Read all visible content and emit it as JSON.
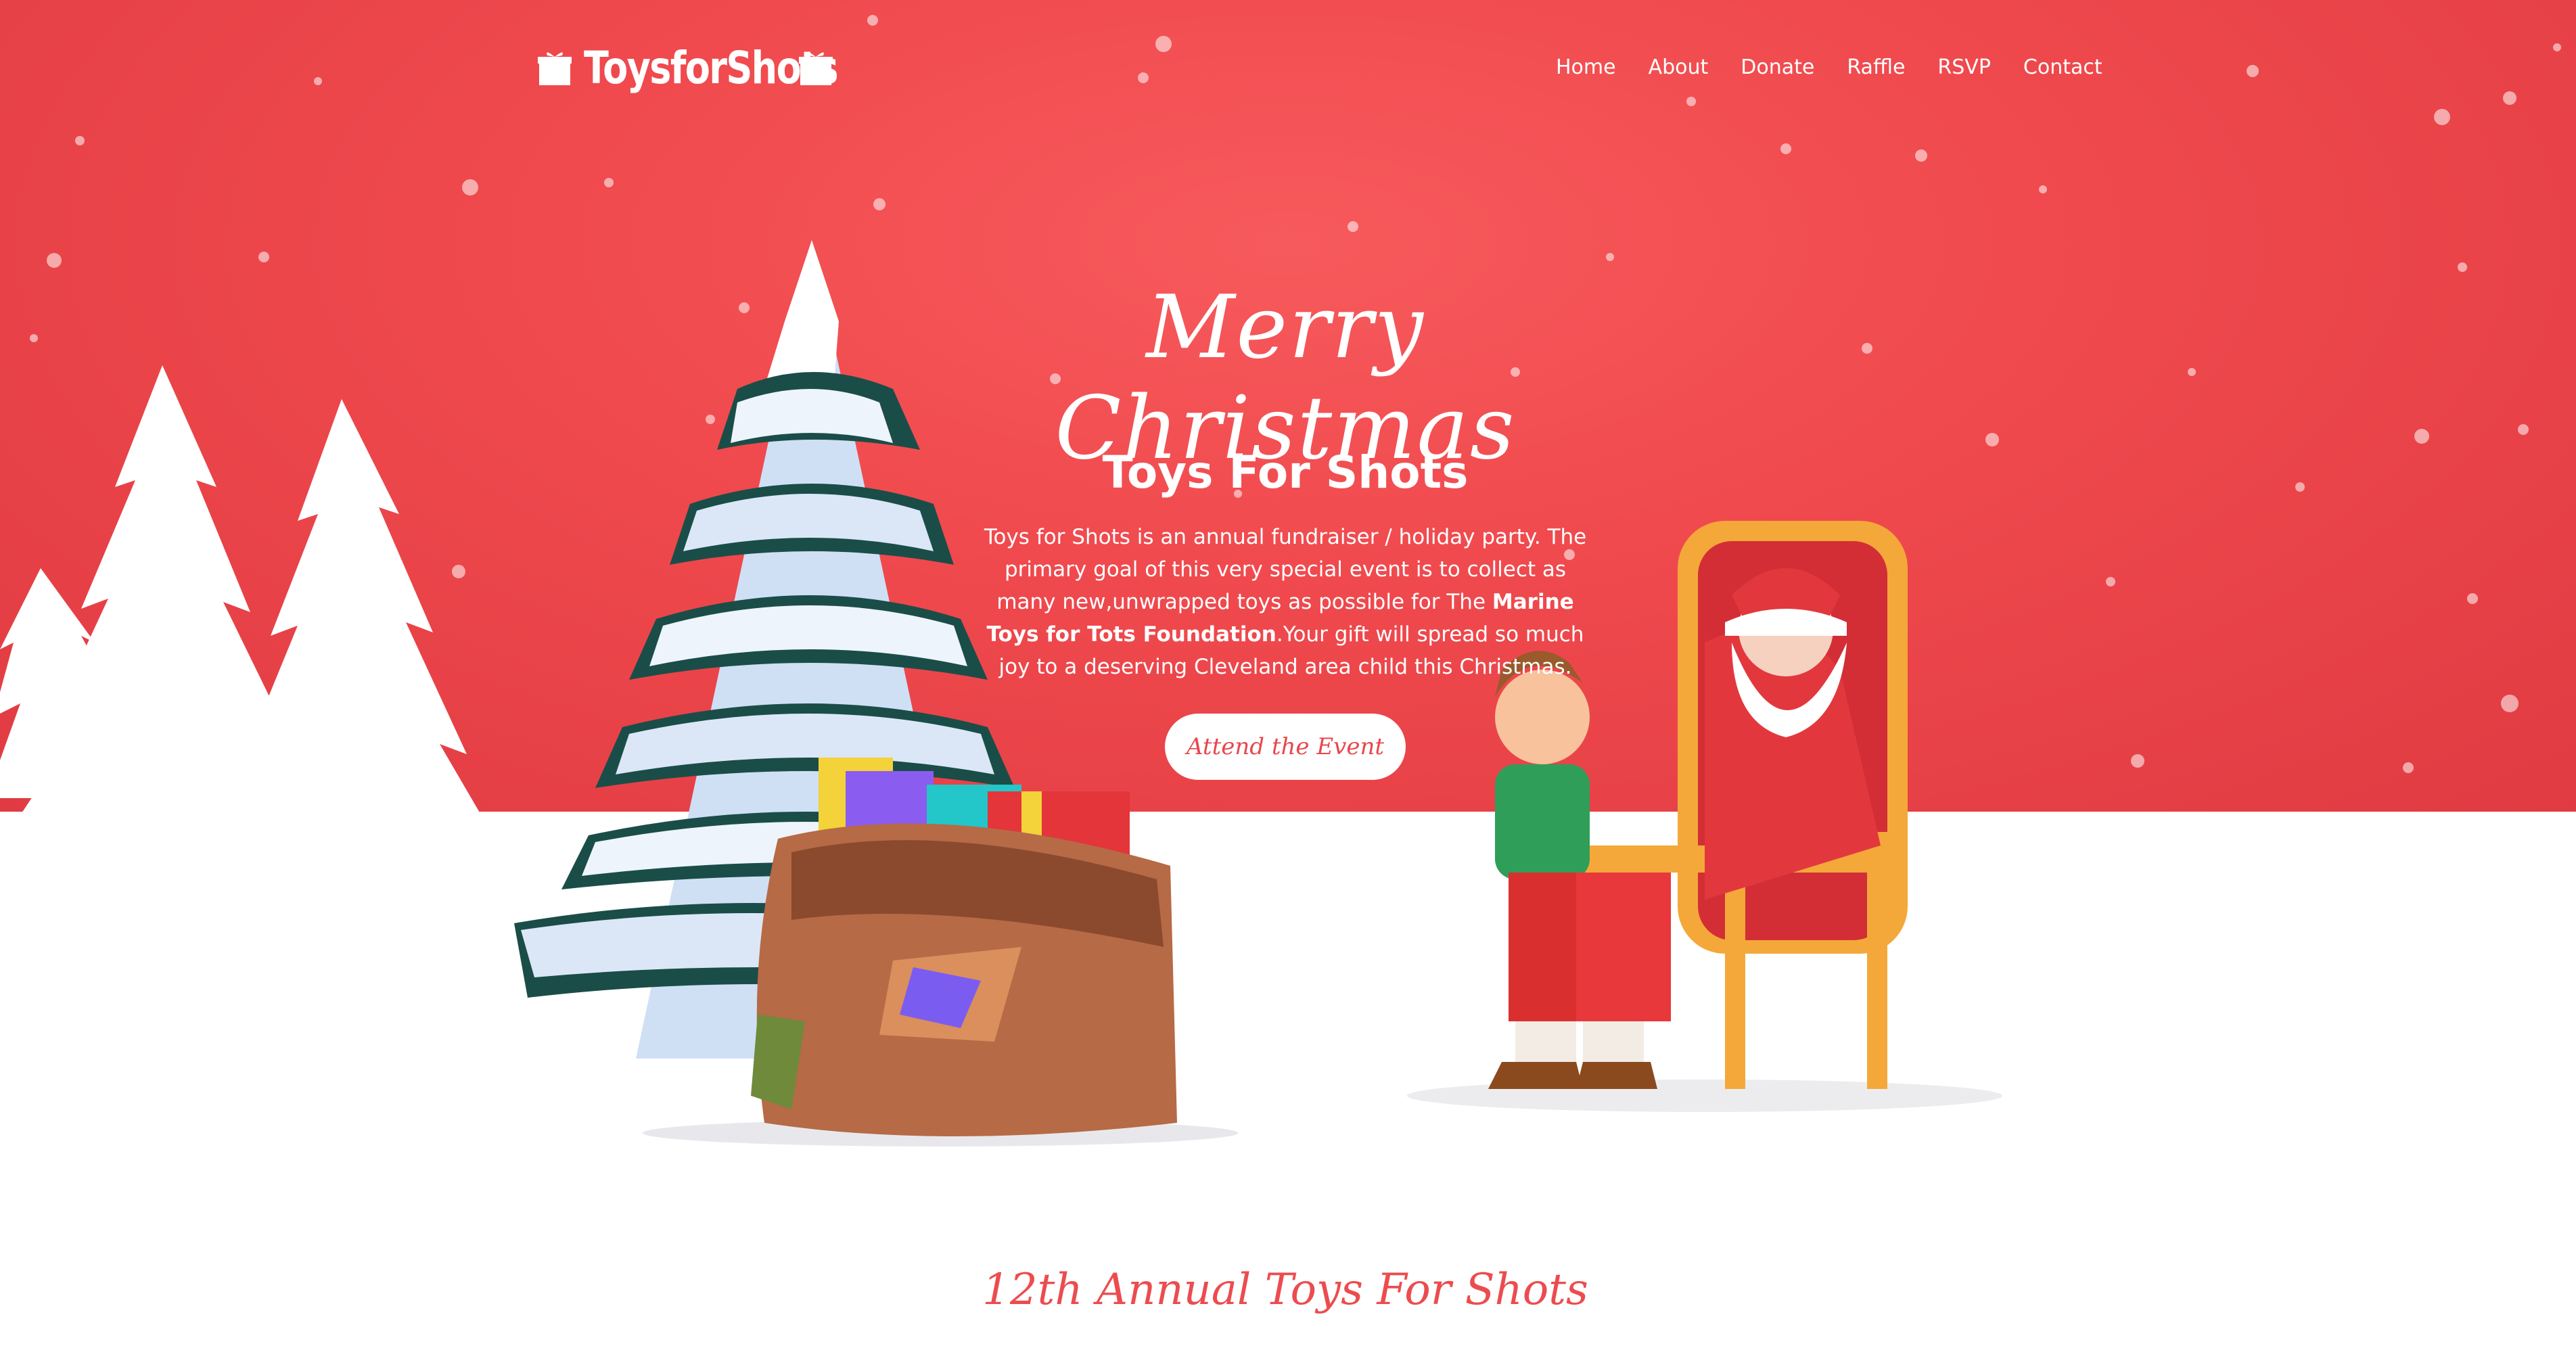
{
  "brand": {
    "logo_text": "ToysforShots"
  },
  "nav": {
    "items": [
      "Home",
      "About",
      "Donate",
      "Raffle",
      "RSVP",
      "Contact"
    ]
  },
  "hero": {
    "script_heading": "Merry Christmas",
    "title": "Toys For Shots",
    "description_part1": "Toys for Shots is an annual fundraiser / holiday party. The primary goal of this very special event is to collect as many new,unwrapped toys as possible for The ",
    "description_bold": "Marine Toys for Tots Foundation",
    "description_part2": ".Your gift will spread so much joy to a deserving Cleveland area child this Christmas.",
    "cta_label": "Attend the Event"
  },
  "section": {
    "title": "12th Annual Toys For Shots"
  },
  "colors": {
    "hero_red": "#f04a4e",
    "accent": "#ec4c4f",
    "white": "#ffffff"
  },
  "icons": {
    "logo_left": "gift-icon",
    "logo_right": "gift-icon"
  }
}
